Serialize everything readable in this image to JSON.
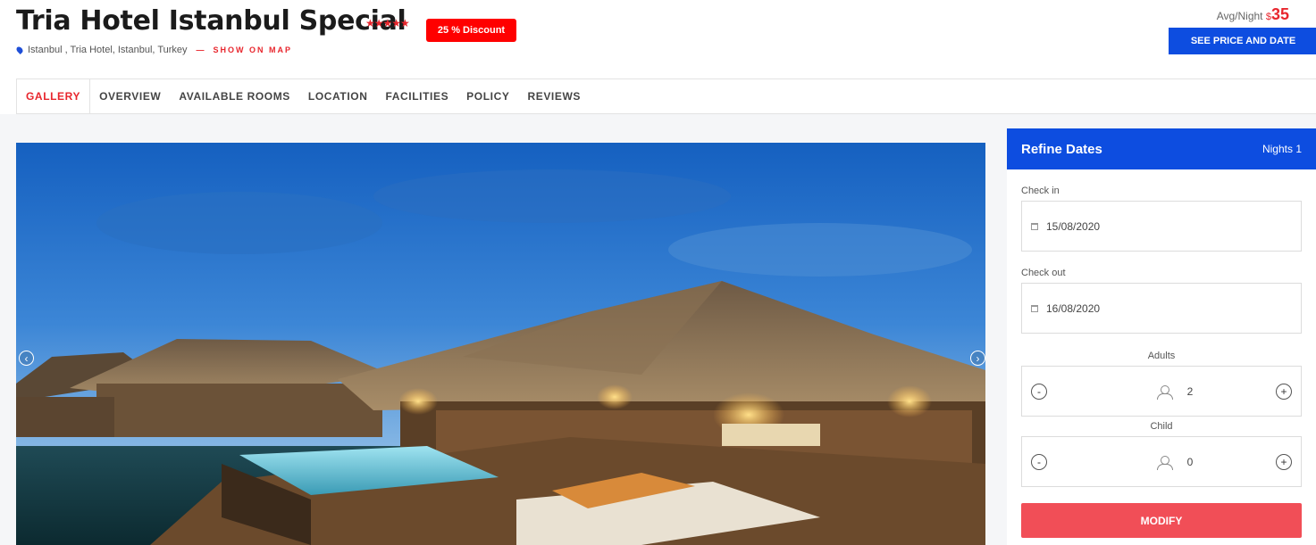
{
  "hotel": {
    "name": "Tria Hotel Istanbul Special",
    "stars": "★★★★★",
    "discount": "25 % Discount",
    "address": "Istanbul , Tria Hotel, Istanbul, Turkey",
    "show_map": "SHOW ON MAP"
  },
  "pricing": {
    "avg_label": "Avg/Night",
    "currency": "$",
    "price": "35",
    "cta": "SEE PRICE AND DATE"
  },
  "tabs": [
    {
      "label": "GALLERY",
      "active": true
    },
    {
      "label": "OVERVIEW",
      "active": false
    },
    {
      "label": "AVAILABLE ROOMS",
      "active": false
    },
    {
      "label": "LOCATION",
      "active": false
    },
    {
      "label": "FACILITIES",
      "active": false
    },
    {
      "label": "POLICY",
      "active": false
    },
    {
      "label": "REVIEWS",
      "active": false
    }
  ],
  "gallery": {
    "prev_icon": "chevron-left-icon",
    "next_icon": "chevron-right-icon"
  },
  "booking": {
    "title": "Refine Dates",
    "nights": "Nights 1",
    "checkin_label": "Check in",
    "checkin_value": "15/08/2020",
    "checkout_label": "Check out",
    "checkout_value": "16/08/2020",
    "adults_label": "Adults",
    "adults_value": "2",
    "child_label": "Child",
    "child_value": "0",
    "minus": "-",
    "plus": "+",
    "modify": "MODIFY"
  },
  "colors": {
    "brand_blue": "#0d4de0",
    "accent_red": "#e8262d",
    "discount_red": "#ff0000",
    "modify_red": "#f14e57"
  }
}
